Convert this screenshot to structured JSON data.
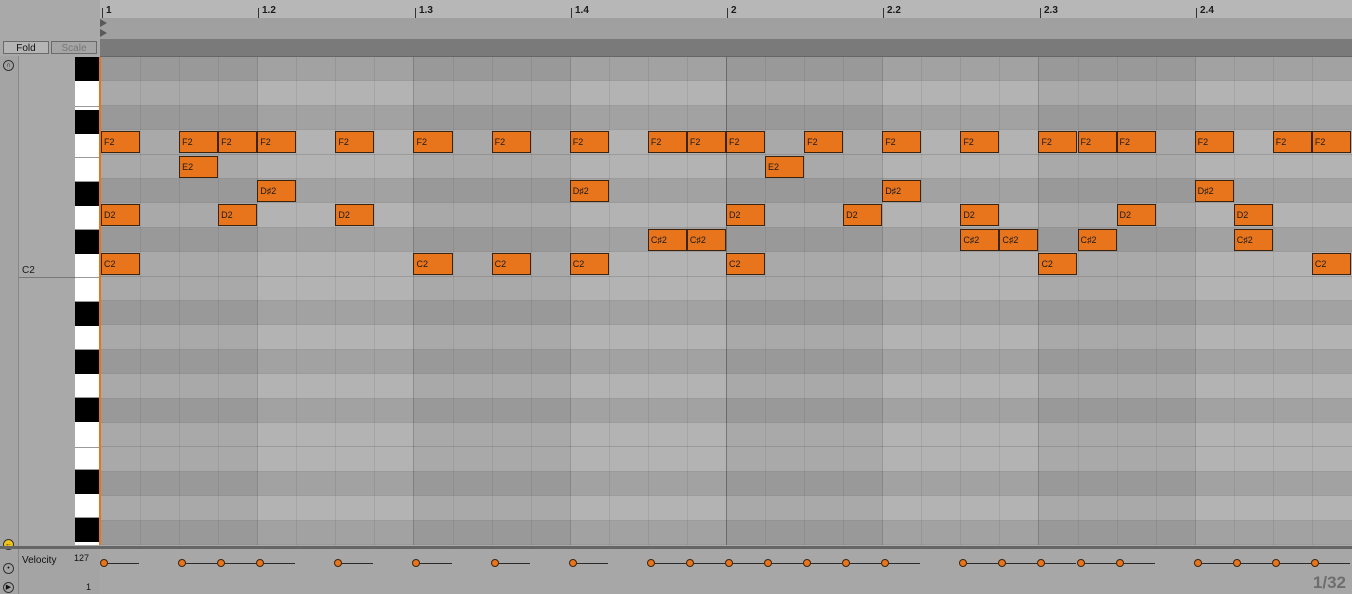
{
  "ruler": {
    "labels": [
      "1",
      "1.2",
      "1.3",
      "1.4",
      "2",
      "2.2",
      "2.3",
      "2.4"
    ]
  },
  "toolbar": {
    "fold_label": "Fold",
    "scale_label": "Scale"
  },
  "keyboard": {
    "reference_label": "C2"
  },
  "notes": [
    {
      "pitch": "F2",
      "step": 0
    },
    {
      "pitch": "F2",
      "step": 2
    },
    {
      "pitch": "F2",
      "step": 3
    },
    {
      "pitch": "F2",
      "step": 4
    },
    {
      "pitch": "F2",
      "step": 6
    },
    {
      "pitch": "F2",
      "step": 8
    },
    {
      "pitch": "F2",
      "step": 10
    },
    {
      "pitch": "F2",
      "step": 12
    },
    {
      "pitch": "F2",
      "step": 14
    },
    {
      "pitch": "F2",
      "step": 15
    },
    {
      "pitch": "F2",
      "step": 16
    },
    {
      "pitch": "F2",
      "step": 18
    },
    {
      "pitch": "F2",
      "step": 20
    },
    {
      "pitch": "F2",
      "step": 22
    },
    {
      "pitch": "F2",
      "step": 24
    },
    {
      "pitch": "F2",
      "step": 25
    },
    {
      "pitch": "F2",
      "step": 26
    },
    {
      "pitch": "F2",
      "step": 28
    },
    {
      "pitch": "F2",
      "step": 30
    },
    {
      "pitch": "F2",
      "step": 31
    },
    {
      "pitch": "E2",
      "step": 2
    },
    {
      "pitch": "E2",
      "step": 17
    },
    {
      "pitch": "D♯2",
      "step": 4
    },
    {
      "pitch": "D♯2",
      "step": 12
    },
    {
      "pitch": "D♯2",
      "step": 20
    },
    {
      "pitch": "D♯2",
      "step": 28
    },
    {
      "pitch": "D2",
      "step": 0
    },
    {
      "pitch": "D2",
      "step": 3
    },
    {
      "pitch": "D2",
      "step": 6
    },
    {
      "pitch": "D2",
      "step": 16
    },
    {
      "pitch": "D2",
      "step": 19
    },
    {
      "pitch": "D2",
      "step": 22
    },
    {
      "pitch": "D2",
      "step": 26
    },
    {
      "pitch": "D2",
      "step": 29
    },
    {
      "pitch": "C♯2",
      "step": 14
    },
    {
      "pitch": "C♯2",
      "step": 15
    },
    {
      "pitch": "C♯2",
      "step": 22
    },
    {
      "pitch": "C♯2",
      "step": 23
    },
    {
      "pitch": "C♯2",
      "step": 25
    },
    {
      "pitch": "C♯2",
      "step": 29
    },
    {
      "pitch": "C2",
      "step": 0
    },
    {
      "pitch": "C2",
      "step": 8
    },
    {
      "pitch": "C2",
      "step": 10
    },
    {
      "pitch": "C2",
      "step": 12
    },
    {
      "pitch": "C2",
      "step": 16
    },
    {
      "pitch": "C2",
      "step": 24
    },
    {
      "pitch": "C2",
      "step": 31
    }
  ],
  "velocity": {
    "label": "Velocity",
    "max_label": "127",
    "min_label": "1",
    "steps": [
      0,
      2,
      3,
      4,
      6,
      8,
      10,
      12,
      14,
      15,
      16,
      17,
      18,
      19,
      20,
      22,
      23,
      24,
      25,
      26,
      28,
      29,
      30,
      31
    ]
  },
  "status": {
    "page_count": "1/32"
  },
  "colors": {
    "note": "#e8741c",
    "playhead": "#e8741c"
  },
  "icons": [
    "headphones-icon",
    "fold-toggle-icon",
    "velocity-lane-icon",
    "play-icon"
  ]
}
